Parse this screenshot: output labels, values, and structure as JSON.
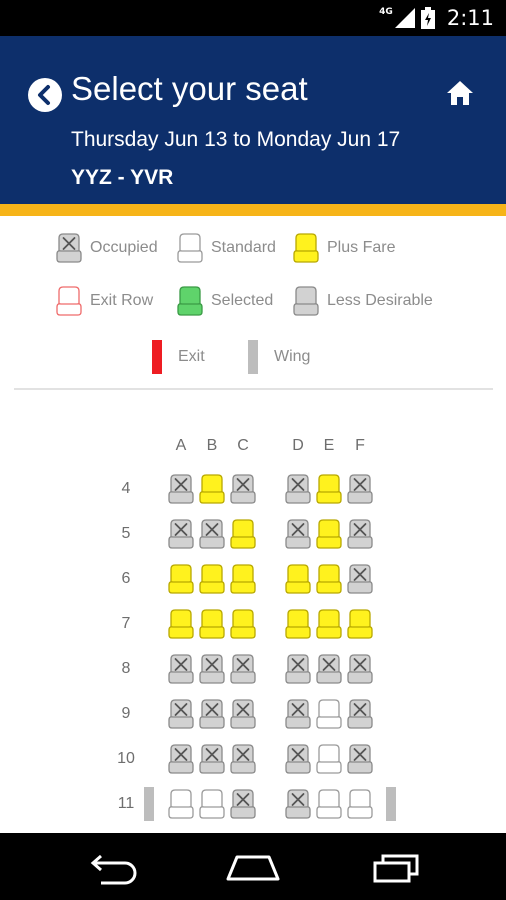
{
  "status_bar": {
    "network": "4G",
    "time": "2:11",
    "icons": [
      "signal-icon",
      "battery-icon"
    ]
  },
  "header": {
    "title": "Select your seat",
    "dates": "Thursday Jun 13 to Monday Jun 17",
    "route": "YYZ - YVR",
    "background_color": "#0d2f6b",
    "accent_color": "#f6b418"
  },
  "legend": {
    "occupied": "Occupied",
    "standard": "Standard",
    "plus_fare": "Plus Fare",
    "exit_row": "Exit Row",
    "selected": "Selected",
    "less_desirable": "Less Desirable",
    "exit": "Exit",
    "wing": "Wing"
  },
  "colors": {
    "plus_fare": "#fff21e",
    "selected": "#5fd36b",
    "exit_row_outline": "#ef6b6b",
    "occupied": "#d2d2d2",
    "exit_bar": "#ee1d23",
    "wing_bar": "#bdbdbd"
  },
  "seat_map": {
    "columns": [
      "A",
      "B",
      "C",
      "D",
      "E",
      "F"
    ],
    "rows": [
      {
        "number": "4",
        "seats": [
          "occupied",
          "plus",
          "occupied",
          "occupied",
          "plus",
          "occupied"
        ],
        "wing": false
      },
      {
        "number": "5",
        "seats": [
          "occupied",
          "occupied",
          "plus",
          "occupied",
          "plus",
          "occupied"
        ],
        "wing": false
      },
      {
        "number": "6",
        "seats": [
          "plus",
          "plus",
          "plus",
          "plus",
          "plus",
          "occupied"
        ],
        "wing": false
      },
      {
        "number": "7",
        "seats": [
          "plus",
          "plus",
          "plus",
          "plus",
          "plus",
          "plus"
        ],
        "wing": false
      },
      {
        "number": "8",
        "seats": [
          "occupied",
          "occupied",
          "occupied",
          "occupied",
          "occupied",
          "occupied"
        ],
        "wing": false
      },
      {
        "number": "9",
        "seats": [
          "occupied",
          "occupied",
          "occupied",
          "occupied",
          "standard",
          "occupied"
        ],
        "wing": false
      },
      {
        "number": "10",
        "seats": [
          "occupied",
          "occupied",
          "occupied",
          "occupied",
          "standard",
          "occupied"
        ],
        "wing": false
      },
      {
        "number": "11",
        "seats": [
          "standard",
          "standard",
          "occupied",
          "occupied",
          "standard",
          "standard"
        ],
        "wing": true
      }
    ]
  },
  "nav_bar": {
    "icons": [
      "back-nav-icon",
      "home-nav-icon",
      "recents-nav-icon"
    ]
  }
}
